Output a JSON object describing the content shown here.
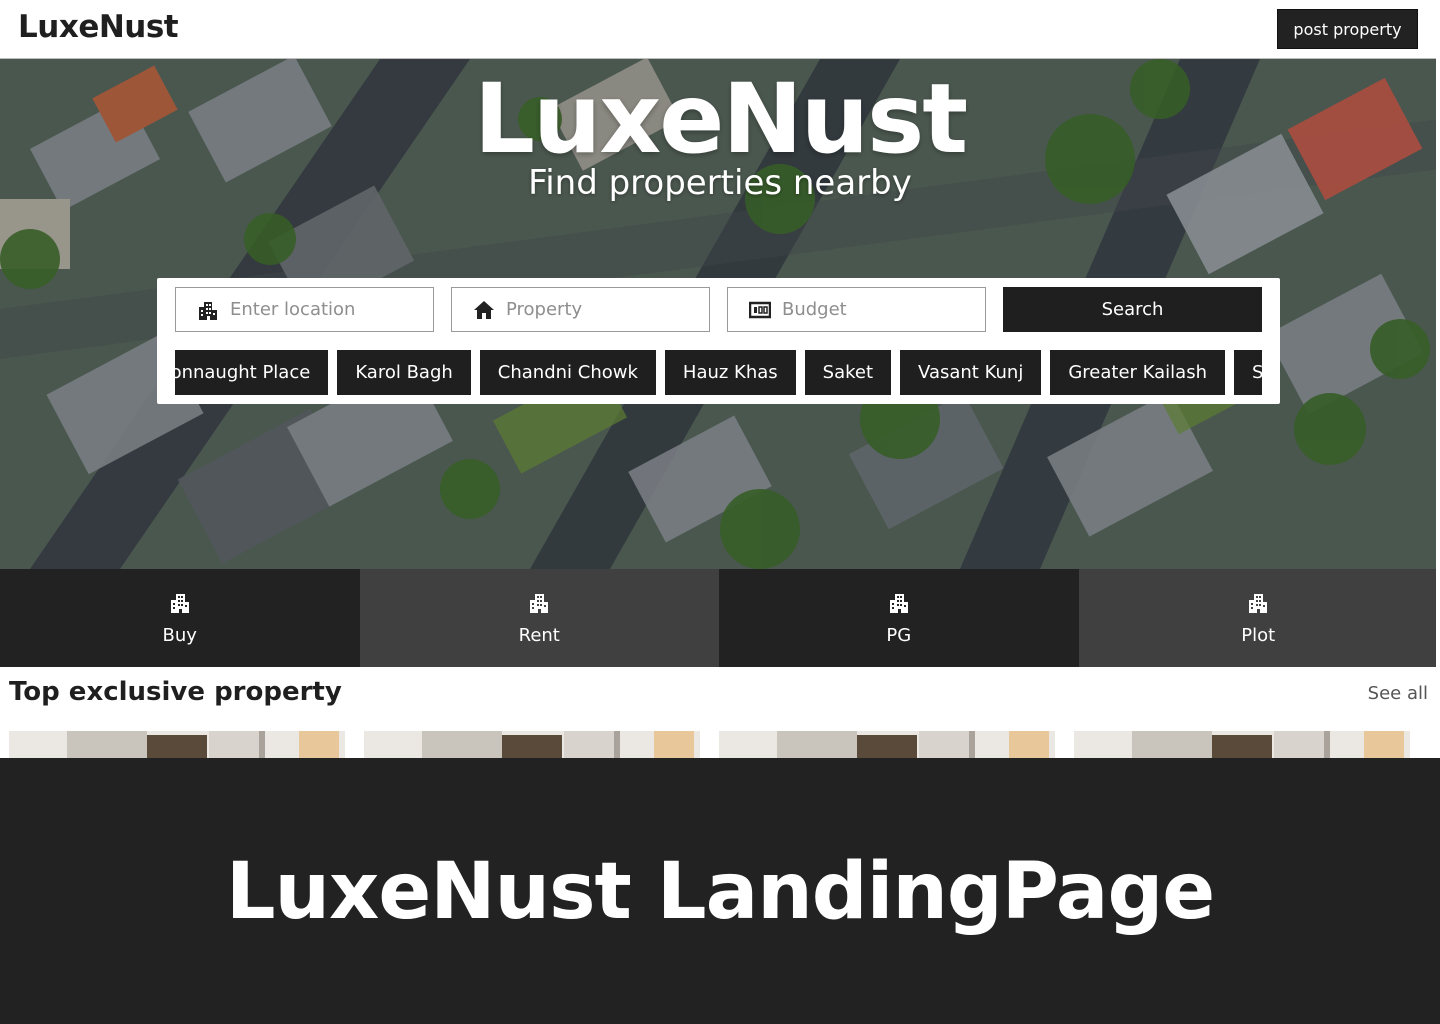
{
  "nav": {
    "brand": "LuxeNust",
    "post_label": "post property"
  },
  "hero": {
    "title": "LuxeNust",
    "subtitle": "Find properties nearby"
  },
  "search": {
    "location_placeholder": "Enter location",
    "property_placeholder": "Property",
    "budget_placeholder": "Budget",
    "button_label": "Search",
    "icons": [
      "city-icon",
      "home-icon",
      "budget-icon"
    ],
    "chips": [
      "Connaught Place",
      "Karol Bagh",
      "Chandni Chowk",
      "Hauz Khas",
      "Saket",
      "Vasant Kunj",
      "Greater Kailash",
      "Shahdara"
    ]
  },
  "categories": [
    {
      "label": "Buy",
      "icon": "building-icon"
    },
    {
      "label": "Rent",
      "icon": "building-icon"
    },
    {
      "label": "PG",
      "icon": "building-icon"
    },
    {
      "label": "Plot",
      "icon": "building-icon"
    }
  ],
  "section": {
    "title": "Top exclusive property",
    "see_all": "See all"
  },
  "banner": {
    "text": "LuxeNust LandingPage"
  },
  "colors": {
    "primary_dark": "#222222",
    "tab_alt": "#404040",
    "white": "#ffffff",
    "placeholder": "#8e8e8e"
  }
}
